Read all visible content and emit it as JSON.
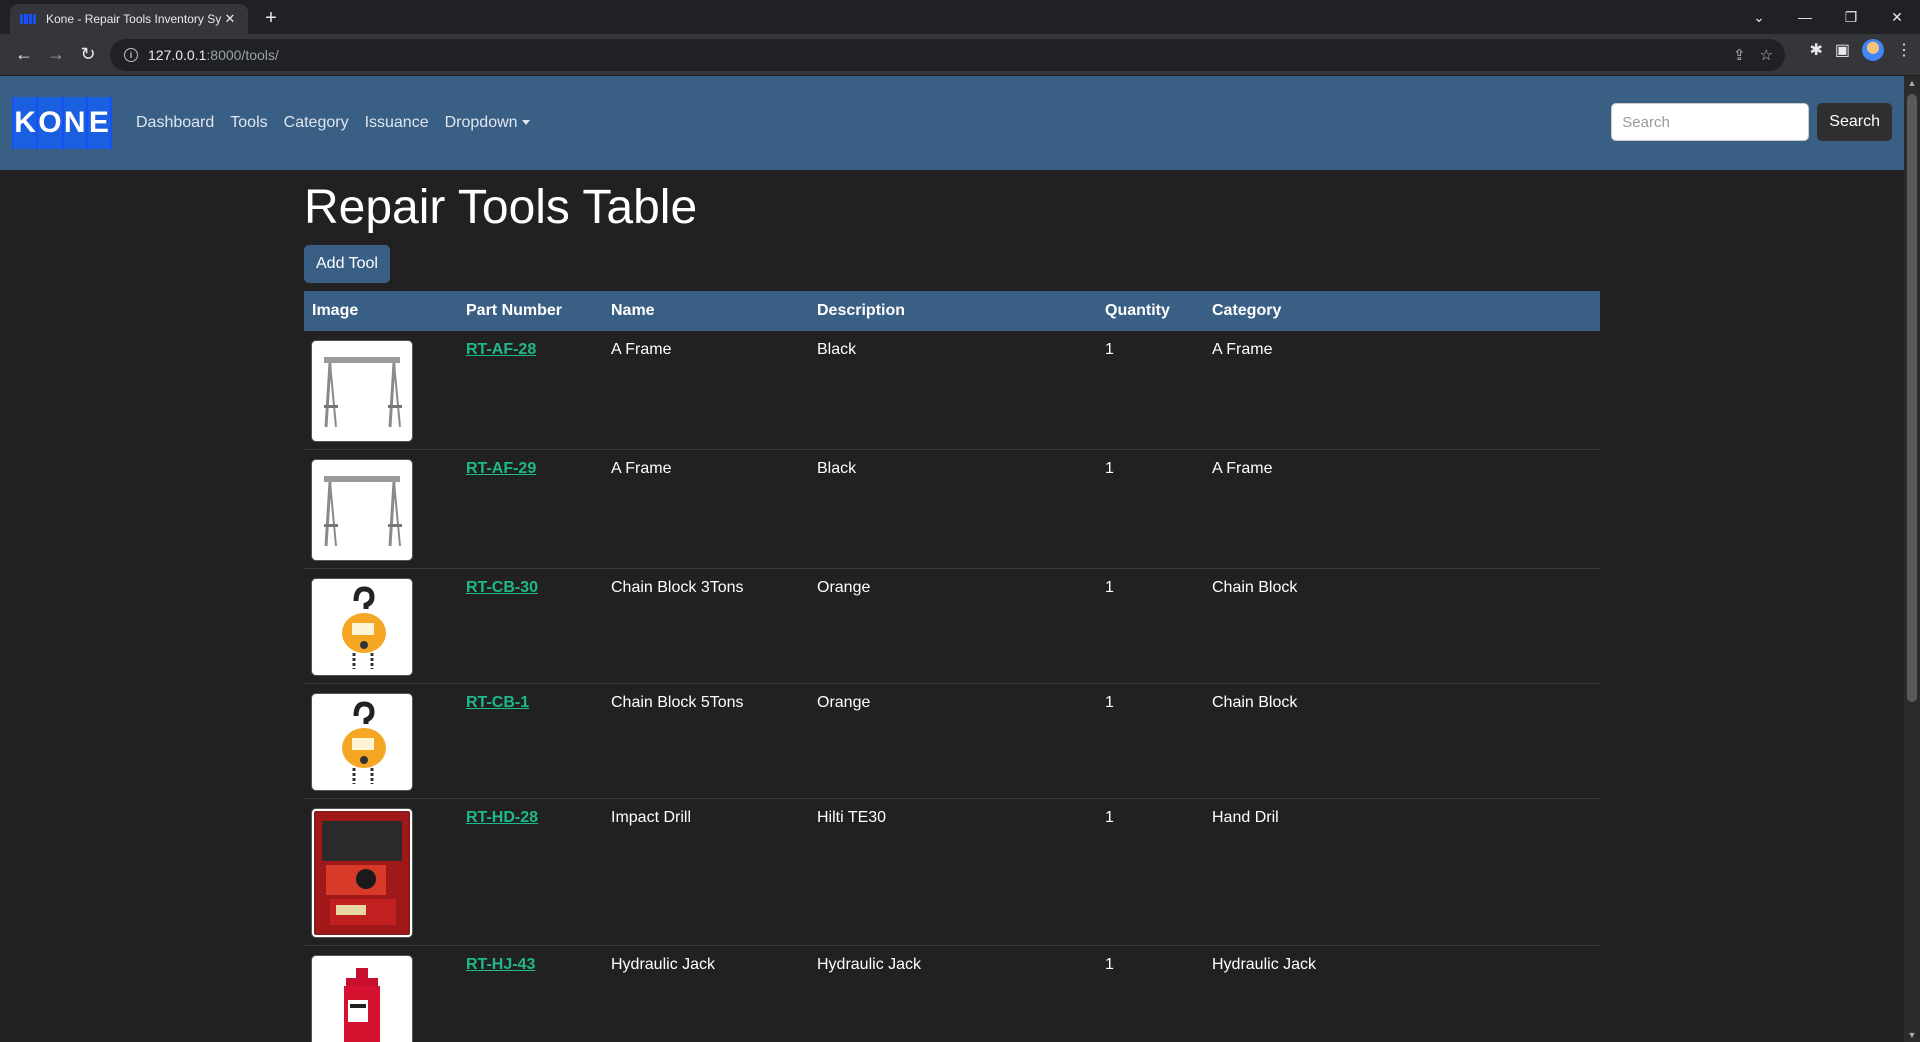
{
  "browser": {
    "tab_title": "Kone - Repair Tools Inventory Sy",
    "url_host": "127.0.0.1",
    "url_rest": ":8000/tools/"
  },
  "navbar": {
    "brand_letters": [
      "K",
      "O",
      "N",
      "E"
    ],
    "links": [
      "Dashboard",
      "Tools",
      "Category",
      "Issuance",
      "Dropdown"
    ],
    "search_placeholder": "Search",
    "search_button": "Search"
  },
  "page": {
    "title": "Repair Tools Table",
    "add_button": "Add Tool"
  },
  "table": {
    "headers": [
      "Image",
      "Part Number",
      "Name",
      "Description",
      "Quantity",
      "Category"
    ],
    "rows": [
      {
        "image": "a-frame",
        "part_number": "RT-AF-28",
        "name": "A Frame",
        "description": "Black",
        "quantity": "1",
        "category": "A Frame"
      },
      {
        "image": "a-frame",
        "part_number": "RT-AF-29",
        "name": "A Frame",
        "description": "Black",
        "quantity": "1",
        "category": "A Frame"
      },
      {
        "image": "chain-block",
        "part_number": "RT-CB-30",
        "name": "Chain Block 3Tons",
        "description": "Orange",
        "quantity": "1",
        "category": "Chain Block"
      },
      {
        "image": "chain-block",
        "part_number": "RT-CB-1",
        "name": "Chain Block 5Tons",
        "description": "Orange",
        "quantity": "1",
        "category": "Chain Block"
      },
      {
        "image": "impact-drill",
        "part_number": "RT-HD-28",
        "name": "Impact Drill",
        "description": "Hilti TE30",
        "quantity": "1",
        "category": "Hand Dril"
      },
      {
        "image": "hydraulic-jack",
        "part_number": "RT-HJ-43",
        "name": "Hydraulic Jack",
        "description": "Hydraulic Jack",
        "quantity": "1",
        "category": "Hydraulic Jack"
      }
    ]
  }
}
